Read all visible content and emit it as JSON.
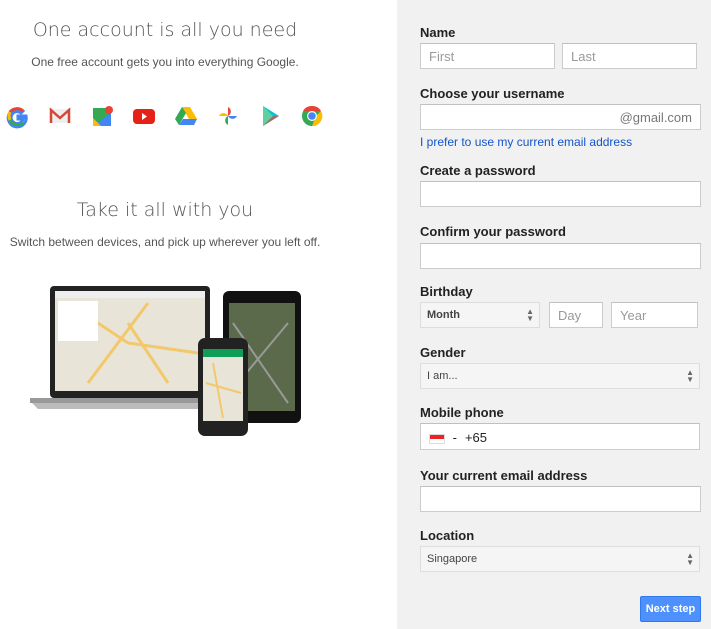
{
  "left": {
    "title1": "One account is all you need",
    "sub1": "One free account gets you into everything Google.",
    "icons": [
      "google-icon",
      "gmail-icon",
      "maps-icon",
      "youtube-icon",
      "drive-icon",
      "photos-icon",
      "play-icon",
      "chrome-icon"
    ],
    "title2": "Take it all with you",
    "sub2": "Switch between devices, and pick up wherever you left off."
  },
  "form": {
    "name_label": "Name",
    "first_placeholder": "First",
    "last_placeholder": "Last",
    "username_label": "Choose your username",
    "username_suffix": "@gmail.com",
    "prefer_link": "I prefer to use my current email address",
    "password_label": "Create a password",
    "confirm_label": "Confirm your password",
    "birthday_label": "Birthday",
    "month": "Month",
    "day_placeholder": "Day",
    "year_placeholder": "Year",
    "gender_label": "Gender",
    "gender": "I am...",
    "phone_label": "Mobile phone",
    "phone_dash": "-",
    "phone_value": "+65",
    "email_label": "Your current email address",
    "location_label": "Location",
    "location": "Singapore",
    "next": "Next step"
  },
  "colors": {
    "accent": "#4d90fe",
    "link": "#1155cc",
    "panel": "#f1f1f1"
  }
}
